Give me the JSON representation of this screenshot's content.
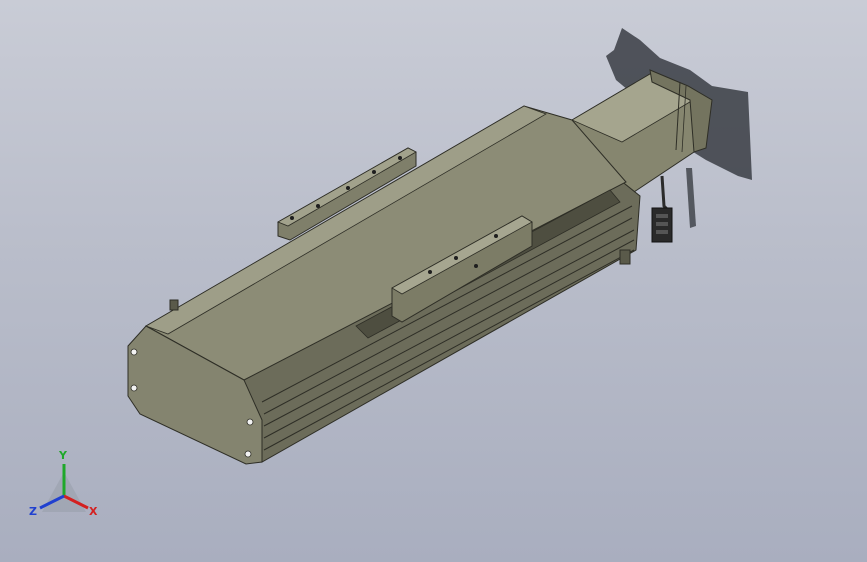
{
  "viewport": {
    "background_top": "#c9ccd6",
    "background_bottom": "#a9aebf"
  },
  "model": {
    "body_color": "#84846f",
    "body_dark": "#6c6c5a",
    "body_light": "#9c9c86",
    "motor_color": "#8a8a74",
    "shadow_color": "#3a3d44"
  },
  "triad": {
    "x_label": "X",
    "y_label": "Y",
    "z_label": "Z",
    "x_color": "#d42020",
    "y_color": "#1fa82a",
    "z_color": "#2040d0"
  }
}
